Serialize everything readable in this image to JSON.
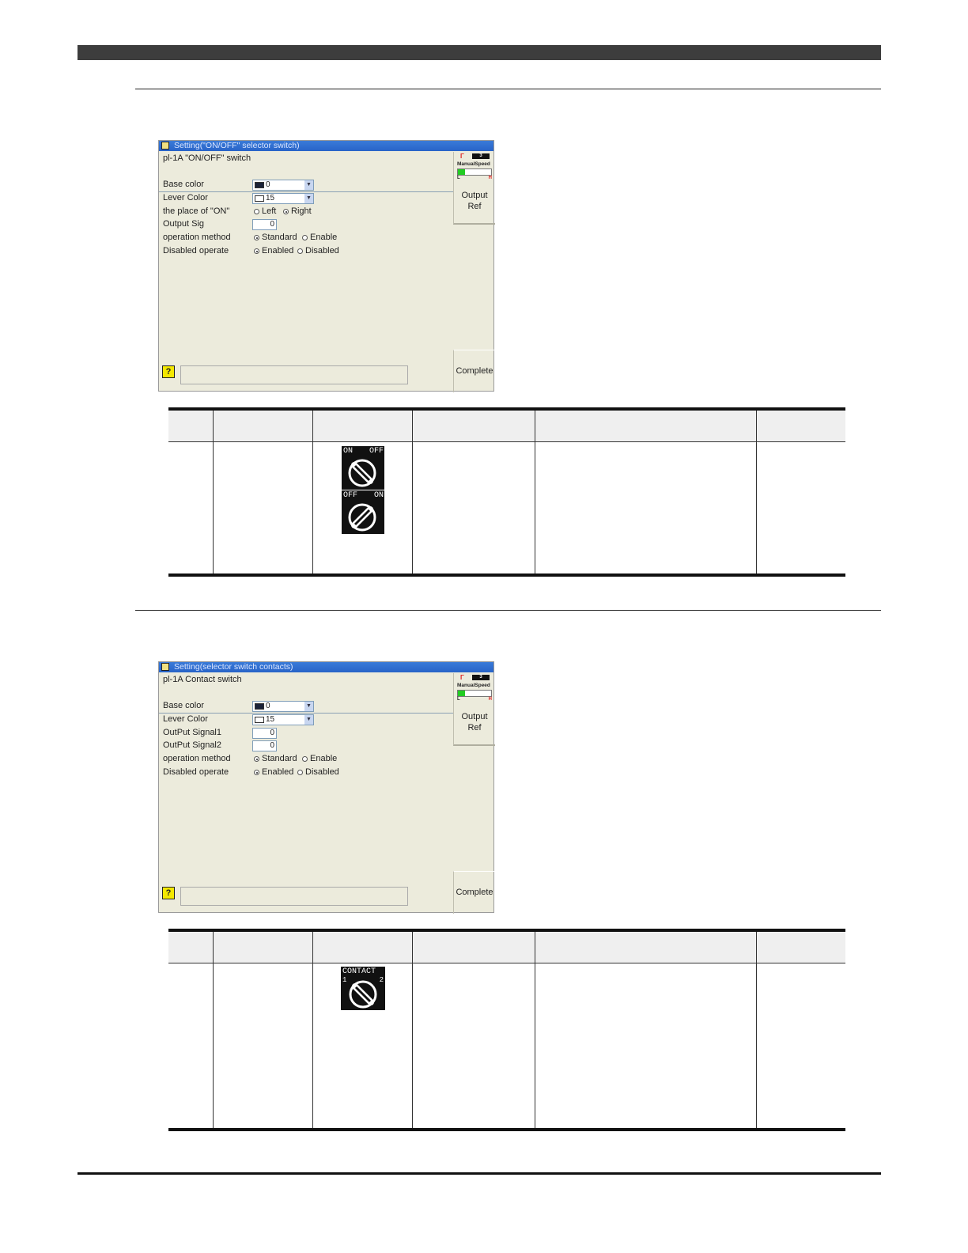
{
  "section1": {
    "dialog": {
      "title": "Setting(\"ON/OFF\" selector switch)",
      "subtitle": "pl-1A \"ON/OFF\" switch",
      "fields": [
        {
          "label": "Base color",
          "value": "0"
        },
        {
          "label": "Lever Color",
          "value": "15"
        },
        {
          "label": "the place of \"ON\""
        },
        {
          "label": "Output Sig",
          "value": "0"
        },
        {
          "label": "operation method"
        },
        {
          "label": "Disabled operate"
        }
      ],
      "place_options": [
        "Left",
        "Right"
      ],
      "method_options": [
        "Standard",
        "Enable"
      ],
      "disabled_options": [
        "Enabled",
        "Disabled"
      ],
      "status": {
        "indicator": "3",
        "label": "ManualSpeed",
        "low": "L",
        "high": "H",
        "mark": "1",
        "level_percent": 22
      },
      "output_ref": [
        "Output",
        "Ref"
      ],
      "complete_label": "Complete",
      "help_icon": "?"
    },
    "icons": [
      {
        "left": "ON",
        "right": "OFF",
        "name": "on-off-knob-icon"
      },
      {
        "left": "OFF",
        "right": "ON",
        "name": "off-on-knob-icon"
      }
    ]
  },
  "section2": {
    "dialog": {
      "title": "Setting(selector switch contacts)",
      "subtitle": "pl-1A Contact switch",
      "fields": [
        {
          "label": "Base color",
          "value": "0"
        },
        {
          "label": "Lever Color",
          "value": "15"
        },
        {
          "label": "OutPut Signal1",
          "value": "0"
        },
        {
          "label": "OutPut Signal2",
          "value": "0"
        },
        {
          "label": "operation method"
        },
        {
          "label": "Disabled operate"
        }
      ],
      "method_options": [
        "Standard",
        "Enable"
      ],
      "disabled_options": [
        "Enabled",
        "Disabled"
      ],
      "status": {
        "indicator": "3",
        "label": "ManualSpeed",
        "low": "L",
        "high": "H",
        "mark": "1",
        "level_percent": 22
      },
      "output_ref": [
        "Output",
        "Ref"
      ],
      "complete_label": "Complete",
      "help_icon": "?"
    },
    "icon": {
      "label": "CONTACT",
      "left": "1",
      "right": "2"
    }
  },
  "colors": {
    "title_bar": "#2a66cc",
    "dialog_bg": "#ecebdc",
    "table_head": "#efefef",
    "accent_green": "#22cc22"
  }
}
